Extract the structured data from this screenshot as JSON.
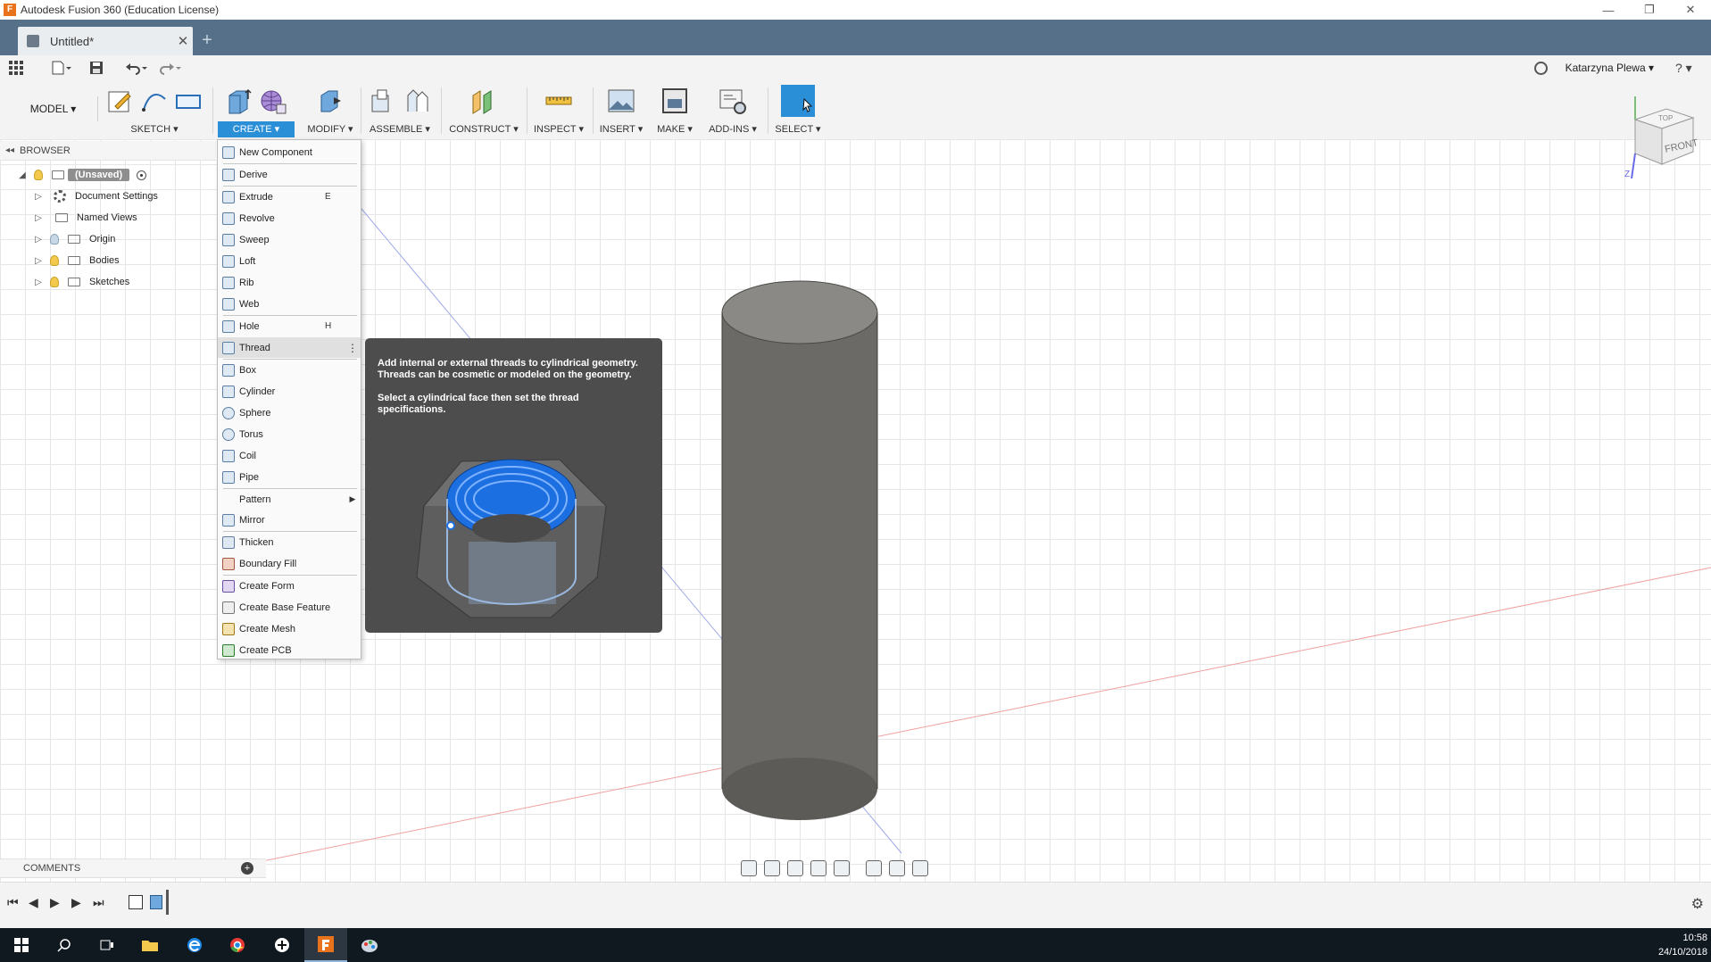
{
  "window": {
    "title": "Autodesk Fusion 360 (Education License)",
    "minimize": "—",
    "restore": "❐",
    "close": "✕"
  },
  "tab": {
    "label": "Untitled*",
    "close": "✕",
    "new": "+"
  },
  "qat": {
    "user": "Katarzyna Plewa ▾",
    "help": "? ▾"
  },
  "ribbon": {
    "workspace": "MODEL ▾",
    "groups": [
      {
        "label": "SKETCH ▾"
      },
      {
        "label": "CREATE ▾"
      },
      {
        "label": "MODIFY ▾"
      },
      {
        "label": "ASSEMBLE ▾"
      },
      {
        "label": "CONSTRUCT ▾"
      },
      {
        "label": "INSPECT ▾"
      },
      {
        "label": "INSERT ▾"
      },
      {
        "label": "MAKE ▾"
      },
      {
        "label": "ADD-INS ▾"
      },
      {
        "label": "SELECT ▾"
      }
    ]
  },
  "browser": {
    "header": "BROWSER",
    "root": "(Unsaved)",
    "items": [
      "Document Settings",
      "Named Views",
      "Origin",
      "Bodies",
      "Sketches"
    ]
  },
  "menu": {
    "items": [
      {
        "label": "New Component",
        "key": ""
      },
      {
        "label": "Derive",
        "key": ""
      },
      {
        "label": "Extrude",
        "key": "E"
      },
      {
        "label": "Revolve",
        "key": ""
      },
      {
        "label": "Sweep",
        "key": ""
      },
      {
        "label": "Loft",
        "key": ""
      },
      {
        "label": "Rib",
        "key": ""
      },
      {
        "label": "Web",
        "key": ""
      },
      {
        "label": "Hole",
        "key": "H"
      },
      {
        "label": "Thread",
        "key": ""
      },
      {
        "label": "Box",
        "key": ""
      },
      {
        "label": "Cylinder",
        "key": ""
      },
      {
        "label": "Sphere",
        "key": ""
      },
      {
        "label": "Torus",
        "key": ""
      },
      {
        "label": "Coil",
        "key": ""
      },
      {
        "label": "Pipe",
        "key": ""
      },
      {
        "label": "Pattern",
        "key": ""
      },
      {
        "label": "Mirror",
        "key": ""
      },
      {
        "label": "Thicken",
        "key": ""
      },
      {
        "label": "Boundary Fill",
        "key": ""
      },
      {
        "label": "Create Form",
        "key": ""
      },
      {
        "label": "Create Base Feature",
        "key": ""
      },
      {
        "label": "Create Mesh",
        "key": ""
      },
      {
        "label": "Create PCB",
        "key": ""
      }
    ],
    "hover_more": "⋮",
    "submenu_arrow": "▶"
  },
  "tooltip": {
    "line1": "Add internal or external threads to cylindrical geometry. Threads can be cosmetic or modeled on the geometry.",
    "line2": "Select a cylindrical face then set the thread specifications."
  },
  "viewcube": {
    "top": "TOP",
    "front": "FRONT",
    "axis_z": "Z"
  },
  "comments": {
    "label": "COMMENTS",
    "add": "+"
  },
  "timeline": {
    "first": "⏮",
    "prev": "◀",
    "play": "▶",
    "next": "▶",
    "last": "⏭",
    "settings": "⚙"
  },
  "taskbar": {
    "time": "10:58",
    "date": "24/10/2018"
  },
  "colors": {
    "accent": "#2b8fd8",
    "tabbar": "#567089",
    "cylinder": "#6b6a66"
  }
}
